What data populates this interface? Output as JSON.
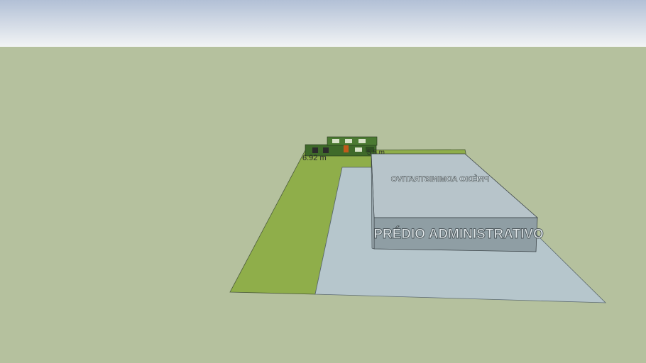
{
  "scene": {
    "building_label_front": "PRÉDIO ADMINISTRATIVO",
    "building_label_roof": "PRÉDIO ADMINISTRATIVO",
    "dimension_label_1": "6.92 m",
    "dimension_label_2": "5.5 m",
    "colors": {
      "sky_top": "#b2c0d6",
      "sky_bottom": "#f2f4f5",
      "ground": "#b5c19e",
      "lawn": "#8fae4a",
      "pavement": "#b6c6cc",
      "roof": "#b7c4ca",
      "wall": "#8f9ea4"
    }
  }
}
